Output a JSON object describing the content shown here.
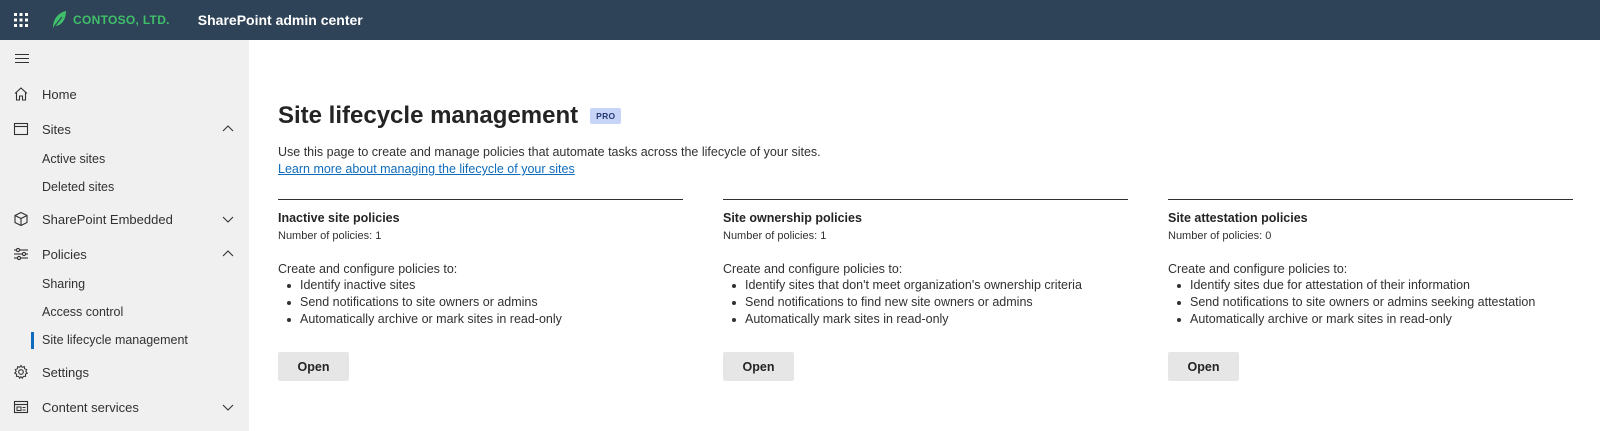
{
  "topbar": {
    "app_icon": "waffle-icon",
    "logo_text": "CONTOSO, LTD.",
    "logo_icon": "leaf-icon",
    "logo_color": "#3fbf6a",
    "bar_color": "#2f4358",
    "title": "SharePoint admin center"
  },
  "sidebar": {
    "items": [
      {
        "label": "Home",
        "icon": "home-icon"
      },
      {
        "label": "Sites",
        "icon": "sites-icon",
        "expanded": true,
        "children": [
          "Active sites",
          "Deleted sites"
        ]
      },
      {
        "label": "SharePoint Embedded",
        "icon": "cube-icon",
        "expanded": false
      },
      {
        "label": "Policies",
        "icon": "sliders-icon",
        "expanded": true,
        "children": [
          "Sharing",
          "Access control",
          "Site lifecycle management"
        ]
      },
      {
        "label": "Settings",
        "icon": "gear-icon"
      },
      {
        "label": "Content services",
        "icon": "content-services-icon",
        "expanded": false
      }
    ],
    "active_item": "Site lifecycle management",
    "accent_color": "#0f6cbd"
  },
  "main": {
    "title": "Site lifecycle management",
    "badge": "PRO",
    "description": "Use this page to create and manage policies that automate tasks across the lifecycle of your sites.",
    "link": "Learn more about managing the lifecycle of your sites",
    "cards": [
      {
        "title": "Inactive site policies",
        "count": "Number of policies: 1",
        "intro": "Create and configure policies to:",
        "bullets": [
          "Identify inactive sites",
          "Send notifications to site owners or admins",
          "Automatically archive or mark sites in read-only"
        ],
        "button": "Open"
      },
      {
        "title": "Site ownership policies",
        "count": "Number of policies: 1",
        "intro": "Create and configure policies to:",
        "bullets": [
          "Identify sites that don't meet organization's ownership criteria",
          "Send notifications to find new site owners or admins",
          "Automatically mark sites in read-only"
        ],
        "button": "Open"
      },
      {
        "title": "Site attestation policies",
        "count": "Number of policies: 0",
        "intro": "Create and configure policies to:",
        "bullets": [
          "Identify sites due for attestation of their information",
          "Send notifications to site owners or admins seeking attestation",
          "Automatically archive or mark sites in read-only"
        ],
        "button": "Open"
      }
    ]
  }
}
